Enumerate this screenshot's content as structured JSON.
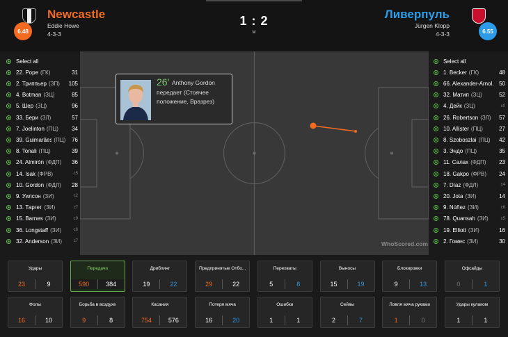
{
  "home": {
    "name": "Newcastle",
    "coach": "Eddie Howe",
    "formation": "4-3-3",
    "rating": "6.48",
    "color": "#f26b21"
  },
  "away": {
    "name": "Ливерпуль",
    "coach": "Jürgen Klopp",
    "formation": "4-3-3",
    "rating": "6.55",
    "color": "#2d9be8"
  },
  "score": "1 : 2",
  "score_label": "М",
  "home_players": [
    {
      "label": "Select all",
      "num": ""
    },
    {
      "label": "22. Pope",
      "pos": "(ГК)",
      "num": "31"
    },
    {
      "label": "2. Триппьер",
      "pos": "(ЗП)",
      "num": "105"
    },
    {
      "label": "4. Botman",
      "pos": "(ЗЦ)",
      "num": "85"
    },
    {
      "label": "5. Шер",
      "pos": "(ЗЦ)",
      "num": "96"
    },
    {
      "label": "33. Бери",
      "pos": "(ЗЛ)",
      "num": "57"
    },
    {
      "label": "7. Joelinton",
      "pos": "(ПЦ)",
      "num": "34"
    },
    {
      "label": "39. Guimarães",
      "pos": "(ПЦ)",
      "num": "76"
    },
    {
      "label": "8. Tonali",
      "pos": "(ПЦ)",
      "num": "39"
    },
    {
      "label": "24. Almirón",
      "pos": "(ФДП)",
      "num": "36"
    },
    {
      "label": "14. Isak",
      "pos": "(ФРВ)",
      "num": "c5"
    },
    {
      "label": "10. Gordon",
      "pos": "(ФДЛ)",
      "num": "28"
    },
    {
      "label": "9. Уилсон",
      "pos": "(ЗИ)",
      "num": "c2"
    },
    {
      "label": "13. Таргет",
      "pos": "(ЗИ)",
      "num": "c7"
    },
    {
      "label": "15. Barnes",
      "pos": "(ЗИ)",
      "num": "c9"
    },
    {
      "label": "36. Longstaff",
      "pos": "(ЗИ)",
      "num": "c6"
    },
    {
      "label": "32. Anderson",
      "pos": "(ЗИ)",
      "num": "c7"
    }
  ],
  "away_players": [
    {
      "label": "Select all",
      "num": ""
    },
    {
      "label": "1. Becker",
      "pos": "(ГК)",
      "num": "48"
    },
    {
      "label": "66. Alexander-Arnol...",
      "pos": "",
      "num": "50"
    },
    {
      "label": "32. Матип",
      "pos": "(ЗЦ)",
      "num": "52"
    },
    {
      "label": "4. Дейк",
      "pos": "(ЗЦ)",
      "num": "c0"
    },
    {
      "label": "26. Robertson",
      "pos": "(ЗЛ)",
      "num": "57"
    },
    {
      "label": "10. Allister",
      "pos": "(ПЦ)",
      "num": "27"
    },
    {
      "label": "8. Szoboszlai",
      "pos": "(ПЦ)",
      "num": "42"
    },
    {
      "label": "3. Эндо",
      "pos": "(ПЦ)",
      "num": "35"
    },
    {
      "label": "11. Салах",
      "pos": "(ФДП)",
      "num": "23"
    },
    {
      "label": "18. Gakpo",
      "pos": "(ФРВ)",
      "num": "24"
    },
    {
      "label": "7. Díaz",
      "pos": "(ФДЛ)",
      "num": "c4"
    },
    {
      "label": "20. Jota",
      "pos": "(ЗИ)",
      "num": "14"
    },
    {
      "label": "9. Núñez",
      "pos": "(ЗИ)",
      "num": "c6"
    },
    {
      "label": "78. Quansah",
      "pos": "(ЗИ)",
      "num": "c5"
    },
    {
      "label": "19. Elliott",
      "pos": "(ЗИ)",
      "num": "16"
    },
    {
      "label": "2. Гомес",
      "pos": "(ЗИ)",
      "num": "30"
    }
  ],
  "tooltip": {
    "minute": "26'",
    "player": "Anthony Gordon",
    "description": "передает (Стоячее положение, Вразрез)"
  },
  "watermark": "WhoScored.com",
  "stats_row1": [
    {
      "title": "Удары",
      "home": "23",
      "away": "9"
    },
    {
      "title": "Передачи",
      "home": "590",
      "away": "384",
      "active": true
    },
    {
      "title": "Дриблинг",
      "home": "19",
      "away": "22"
    },
    {
      "title": "Предпринятые Отбо...",
      "home": "29",
      "away": "22"
    },
    {
      "title": "Перехваты",
      "home": "5",
      "away": "8"
    },
    {
      "title": "Выносы",
      "home": "15",
      "away": "19"
    },
    {
      "title": "Блокировки",
      "home": "9",
      "away": "13"
    },
    {
      "title": "Офсайды",
      "home": "0",
      "away": "1"
    }
  ],
  "stats_row2": [
    {
      "title": "Фолы",
      "home": "16",
      "away": "10"
    },
    {
      "title": "Борьба в воздухе",
      "home": "9",
      "away": "8"
    },
    {
      "title": "Касания",
      "home": "754",
      "away": "576"
    },
    {
      "title": "Потеря мяча",
      "home": "16",
      "away": "20"
    },
    {
      "title": "Ошибки",
      "home": "1",
      "away": "1"
    },
    {
      "title": "Сейвы",
      "home": "2",
      "away": "7"
    },
    {
      "title": "Ловля мяча руками",
      "home": "1",
      "away": "0"
    },
    {
      "title": "Удары кулаком",
      "home": "1",
      "away": "1"
    }
  ]
}
